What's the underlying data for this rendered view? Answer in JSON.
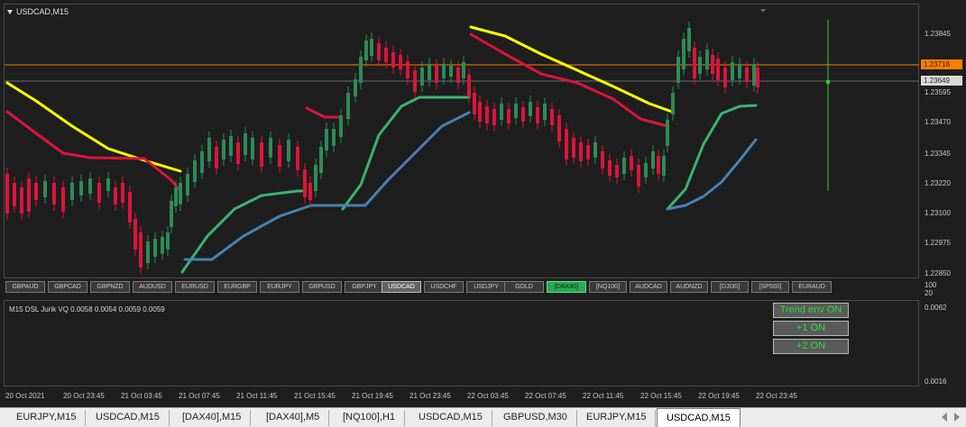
{
  "chart": {
    "title": "USDCAD,M15",
    "price_labels": [
      "1.23845",
      "1.23718",
      "1.23649",
      "1.23595",
      "1.23470",
      "1.23345",
      "1.23220",
      "1.23100",
      "1.22975",
      "1.22850"
    ],
    "hline_price": "1.23718",
    "bid_price": "1.23649",
    "colors": {
      "bull_candle": "#2e8b57",
      "bear_candle": "#dc143c",
      "yellow_line": "#ffff00",
      "red_line": "#dc143c",
      "green_line": "#3cb371",
      "blue_line": "#4682b4",
      "hline": "#ff7f00",
      "vline": "#32cd32"
    }
  },
  "symbols": [
    {
      "label": "GBPAUD",
      "state": "normal"
    },
    {
      "label": "GBPCAD",
      "state": "normal"
    },
    {
      "label": "GBPNZD",
      "state": "normal"
    },
    {
      "label": "AUDUSD",
      "state": "normal"
    },
    {
      "label": "EURUSD",
      "state": "normal"
    },
    {
      "label": "EURGBP",
      "state": "normal"
    },
    {
      "label": "EURJPY",
      "state": "normal"
    },
    {
      "label": "GBPUSD",
      "state": "normal"
    },
    {
      "label": "GBPJPY",
      "state": "normal"
    },
    {
      "label": "USDCAD",
      "state": "active"
    },
    {
      "label": "USDCHF",
      "state": "normal"
    },
    {
      "label": "USDJPY",
      "state": "normal"
    },
    {
      "label": "GOLD",
      "state": "normal"
    },
    {
      "label": "[DAX40]",
      "state": "highlight"
    },
    {
      "label": "[NQ100]",
      "state": "normal"
    },
    {
      "label": "AUDCAD",
      "state": "normal"
    },
    {
      "label": "AUDNZD",
      "state": "normal"
    },
    {
      "label": "[DJI30]",
      "state": "normal"
    },
    {
      "label": "[SP500]",
      "state": "normal"
    },
    {
      "label": "EURAUD",
      "state": "normal"
    }
  ],
  "separator_axis": {
    "top": "100",
    "bottom": "20"
  },
  "indicator": {
    "title": "M15 DSL Jurik VQ 0.0058 0.0054 0.0059 0.0059",
    "axis_top": "0.0062",
    "axis_bottom": "0.0016",
    "buttons": {
      "trend": "Trend env ON",
      "plus1": "+1  ON",
      "plus2": "+2  ON"
    }
  },
  "time_labels": [
    "20 Oct 2021",
    "20 Oct 23:45",
    "21 Oct 03:45",
    "21 Oct 07:45",
    "21 Oct 11:45",
    "21 Oct 15:45",
    "21 Oct 19:45",
    "21 Oct 23:45",
    "22 Oct 03:45",
    "22 Oct 07:45",
    "22 Oct 11:45",
    "22 Oct 15:45",
    "22 Oct 19:45",
    "22 Oct 23:45"
  ],
  "tabs": [
    {
      "label": "EURJPY,M15",
      "active": false
    },
    {
      "label": "USDCAD,M15",
      "active": false
    },
    {
      "label": "[DAX40],M15",
      "active": false
    },
    {
      "label": "[DAX40],M5",
      "active": false
    },
    {
      "label": "[NQ100],H1",
      "active": false
    },
    {
      "label": "USDCAD,M15",
      "active": false
    },
    {
      "label": "GBPUSD,M30",
      "active": false
    },
    {
      "label": "EURJPY,M15",
      "active": false
    },
    {
      "label": "USDCAD,M15",
      "active": true
    }
  ]
}
